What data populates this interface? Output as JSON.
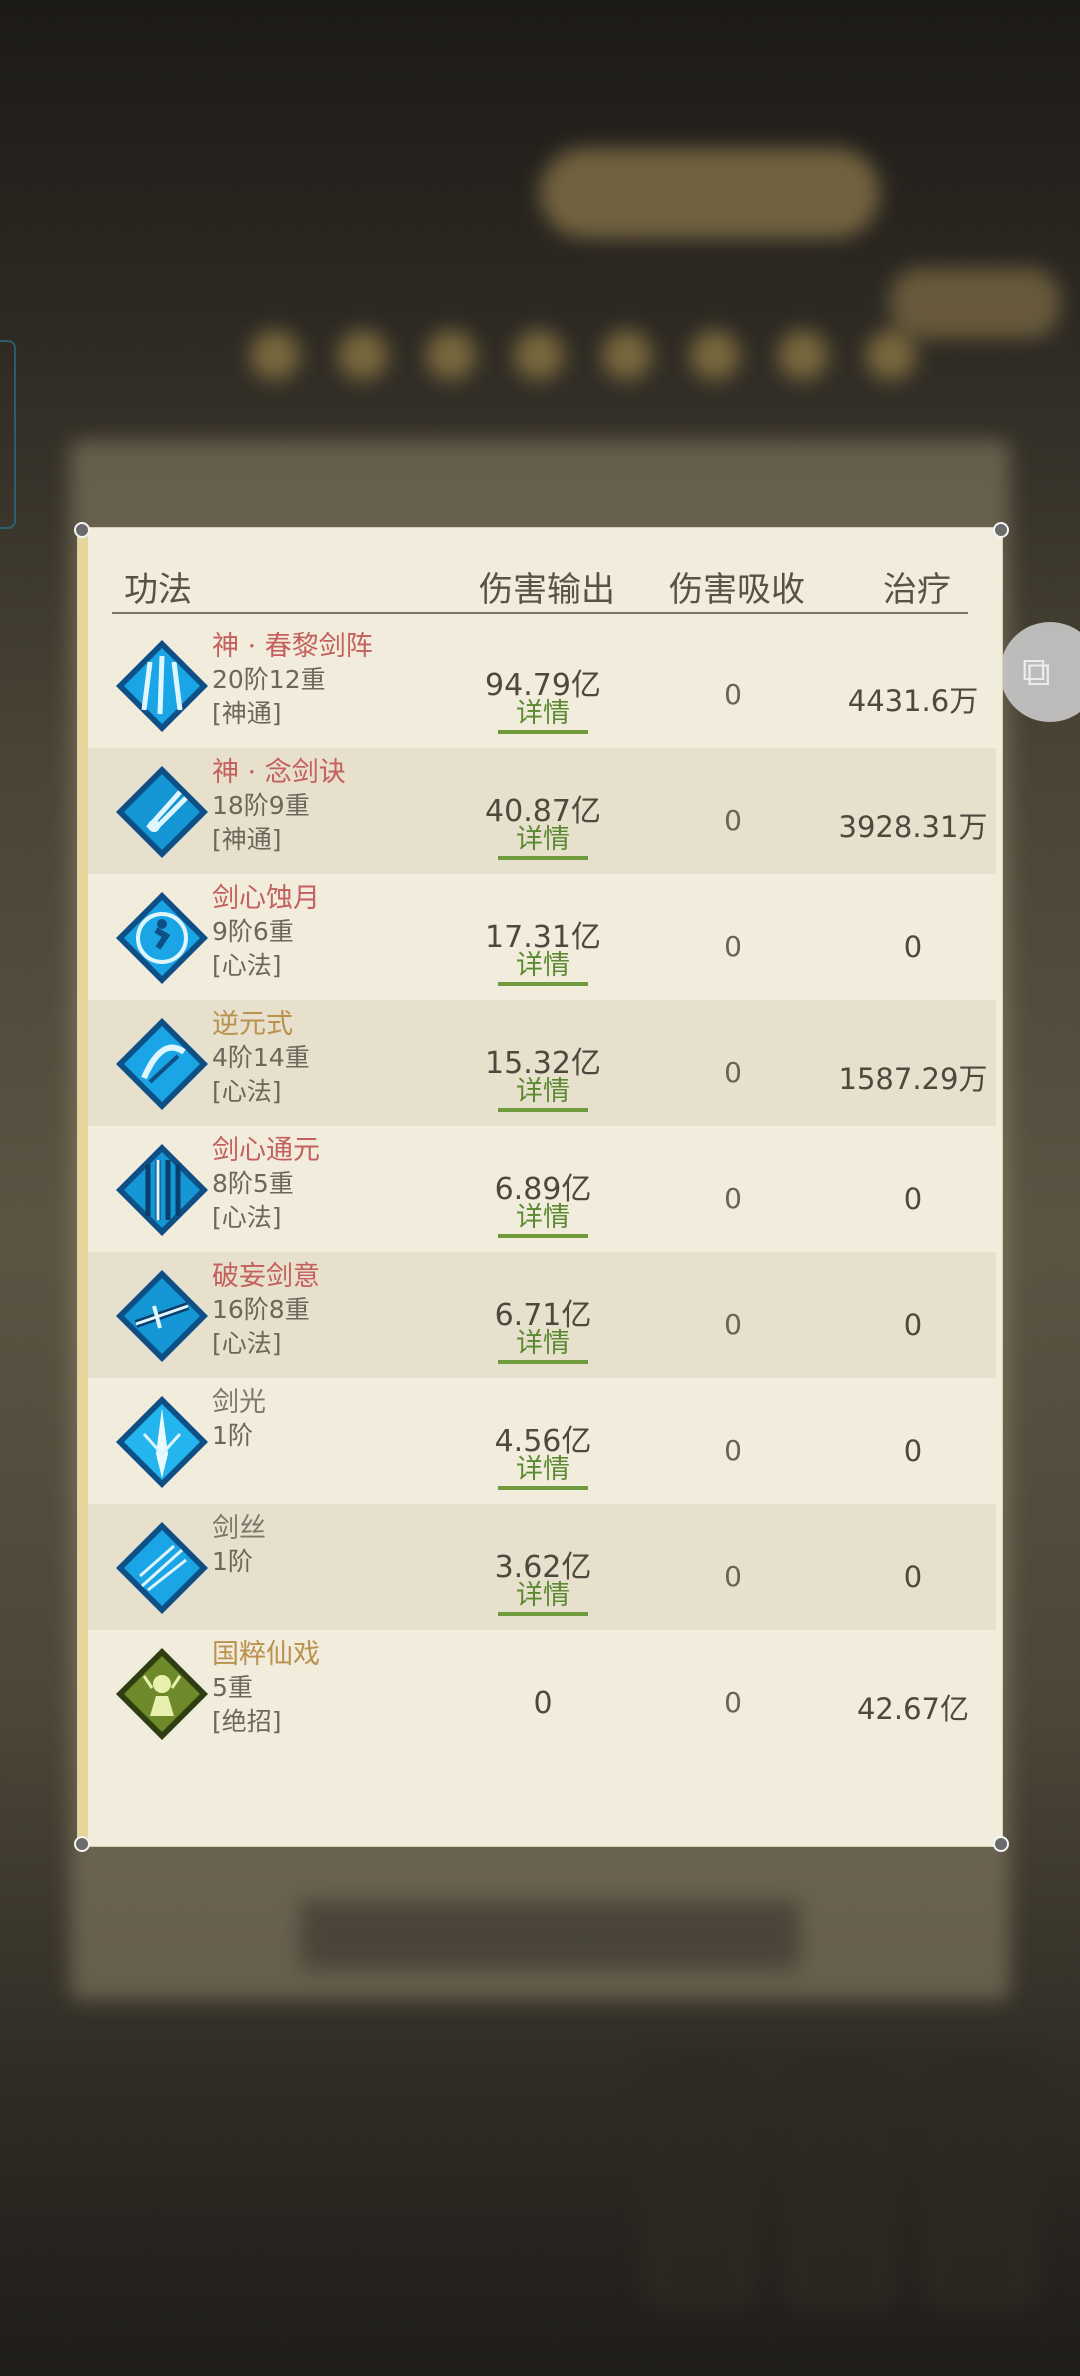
{
  "table": {
    "headers": {
      "name": "功法",
      "damage": "伤害输出",
      "absorb": "伤害吸收",
      "heal": "治疗"
    },
    "detail_label": "详情",
    "rows": [
      {
        "name": "神 · 春黎剑阵",
        "level": "20阶12重",
        "tag": "[神通]",
        "damage": "94.79亿",
        "absorb": "0",
        "heal": "4431.6万",
        "name_color": "pink",
        "icon": "sword-array-icon",
        "has_detail": true
      },
      {
        "name": "神 · 念剑诀",
        "level": "18阶9重",
        "tag": "[神通]",
        "damage": "40.87亿",
        "absorb": "0",
        "heal": "3928.31万",
        "name_color": "pink",
        "icon": "sword-thrust-icon",
        "has_detail": true
      },
      {
        "name": "剑心蚀月",
        "level": "9阶6重",
        "tag": "[心法]",
        "damage": "17.31亿",
        "absorb": "0",
        "heal": "0",
        "name_color": "pink",
        "icon": "moon-figure-icon",
        "has_detail": true
      },
      {
        "name": "逆元式",
        "level": "4阶14重",
        "tag": "[心法]",
        "damage": "15.32亿",
        "absorb": "0",
        "heal": "1587.29万",
        "name_color": "gold",
        "icon": "blade-swirl-icon",
        "has_detail": true
      },
      {
        "name": "剑心通元",
        "level": "8阶5重",
        "tag": "[心法]",
        "damage": "6.89亿",
        "absorb": "0",
        "heal": "0",
        "name_color": "pink",
        "icon": "sword-rain-icon",
        "has_detail": true
      },
      {
        "name": "破妄剑意",
        "level": "16阶8重",
        "tag": "[心法]",
        "damage": "6.71亿",
        "absorb": "0",
        "heal": "0",
        "name_color": "pink",
        "icon": "crossed-sword-icon",
        "has_detail": true
      },
      {
        "name": "剑光",
        "level": "1阶",
        "tag": "",
        "damage": "4.56亿",
        "absorb": "0",
        "heal": "0",
        "name_color": "gray",
        "icon": "sword-light-icon",
        "has_detail": true
      },
      {
        "name": "剑丝",
        "level": "1阶",
        "tag": "",
        "damage": "3.62亿",
        "absorb": "0",
        "heal": "0",
        "name_color": "gray",
        "icon": "sword-thread-icon",
        "has_detail": true
      },
      {
        "name": "国粹仙戏",
        "level": "5重",
        "tag": "[绝招]",
        "damage": "0",
        "absorb": "0",
        "heal": "42.67亿",
        "name_color": "gold",
        "icon": "opera-figure-icon",
        "has_detail": false
      }
    ]
  },
  "colors": {
    "skill_blue": "#1aa6e6",
    "ultimate_green": "#6f8a2a",
    "detail_green": "#5c8a32",
    "name_pink": "#c4605d",
    "name_gold": "#b8924e"
  },
  "side_button": {
    "icon": "share-icon"
  }
}
